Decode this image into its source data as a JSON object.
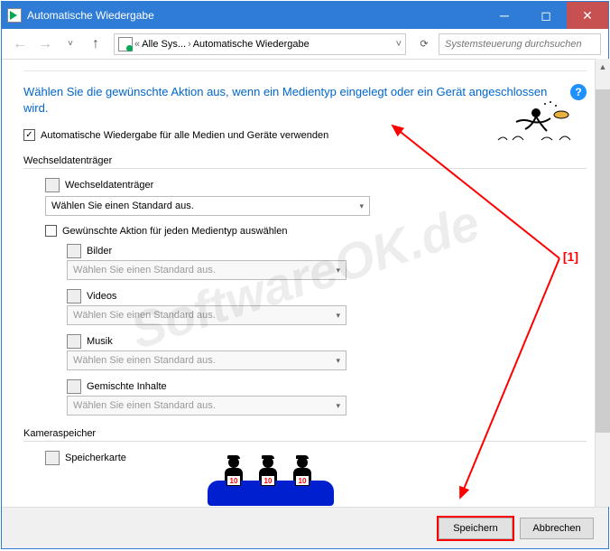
{
  "titlebar": {
    "title": "Automatische Wiedergabe"
  },
  "breadcrumb": {
    "item1": "Alle Sys...",
    "item2": "Automatische Wiedergabe"
  },
  "search": {
    "placeholder": "Systemsteuerung durchsuchen"
  },
  "heading": "Wählen Sie die gewünschte Aktion aus, wenn ein Medientyp eingelegt oder ein Gerät angeschlossen wird.",
  "main_checkbox": {
    "label": "Automatische Wiedergabe für alle Medien und Geräte verwenden",
    "checked": true
  },
  "section_removable": {
    "label": "Wechseldatenträger"
  },
  "removable_drive": {
    "label": "Wechseldatenträger",
    "value": "Wählen Sie einen Standard aus."
  },
  "sub_checkbox": {
    "label": "Gewünschte Aktion für jeden Medientyp auswählen",
    "checked": false
  },
  "media": {
    "pictures": {
      "label": "Bilder",
      "value": "Wählen Sie einen Standard aus."
    },
    "videos": {
      "label": "Videos",
      "value": "Wählen Sie einen Standard aus."
    },
    "music": {
      "label": "Musik",
      "value": "Wählen Sie einen Standard aus."
    },
    "mixed": {
      "label": "Gemischte Inhalte",
      "value": "Wählen Sie einen Standard aus."
    }
  },
  "section_camera": {
    "label": "Kameraspeicher"
  },
  "camera_card": {
    "label": "Speicherkarte"
  },
  "buttons": {
    "save": "Speichern",
    "cancel": "Abbrechen"
  },
  "watermark": "SoftwareOK.de",
  "annotation": {
    "label": "[1]"
  },
  "judge_score": "10"
}
